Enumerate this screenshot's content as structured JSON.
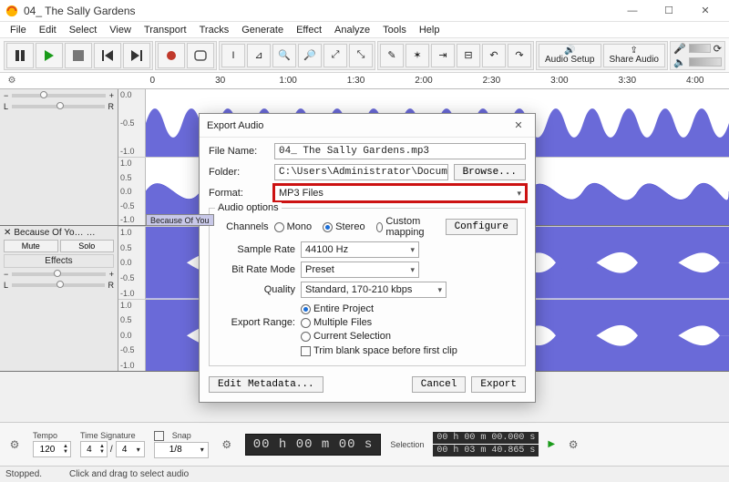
{
  "window": {
    "title": "04_ The Sally Gardens",
    "minimize": "—",
    "maximize": "☐",
    "close": "✕"
  },
  "menu": [
    "File",
    "Edit",
    "Select",
    "View",
    "Transport",
    "Tracks",
    "Generate",
    "Effect",
    "Analyze",
    "Tools",
    "Help"
  ],
  "toolbar": {
    "audio_setup": "Audio Setup",
    "share_audio": "Share Audio"
  },
  "ruler": {
    "marks": [
      "0",
      "30",
      "1:00",
      "1:30",
      "2:00",
      "2:30",
      "3:00",
      "3:30",
      "4:00"
    ]
  },
  "tracks": [
    {
      "name": "",
      "clip_label": "",
      "scale": [
        "1.0",
        "0.5",
        "0.0",
        "-0.5",
        "-1.0"
      ],
      "channels": 2,
      "panel_visible": true
    },
    {
      "name": "Because Of Yo…",
      "mute": "Mute",
      "solo": "Solo",
      "effects": "Effects",
      "pan_l": "L",
      "pan_r": "R",
      "clip_label": "Because Of You",
      "scale": [
        "1.0",
        "0.5",
        "0.0",
        "-0.5",
        "-1.0"
      ],
      "channels": 2,
      "panel_visible": true
    }
  ],
  "bottom": {
    "tempo_label": "Tempo",
    "tempo_value": "120",
    "timesig_label": "Time Signature",
    "timesig_num": "4",
    "timesig_den": "4",
    "snap_label": "Snap",
    "snap_value": "1/8",
    "time_display": "00 h 00 m 00 s",
    "selection_label": "Selection",
    "sel_start": "00 h 00 m 00.000 s",
    "sel_end": "00 h 03 m 40.865 s"
  },
  "status": {
    "left": "Stopped.",
    "hint": "Click and drag to select audio"
  },
  "dialog": {
    "title": "Export Audio",
    "close": "✕",
    "filename_label": "File Name:",
    "filename": "04_ The Sally Gardens.mp3",
    "folder_label": "Folder:",
    "folder": "C:\\Users\\Administrator\\Documents\\Audacity",
    "browse": "Browse...",
    "format_label": "Format:",
    "format": "MP3 Files",
    "audio_options_title": "Audio options",
    "channels_label": "Channels",
    "channels_mono": "Mono",
    "channels_stereo": "Stereo",
    "channels_custom": "Custom mapping",
    "configure": "Configure",
    "sample_rate_label": "Sample Rate",
    "sample_rate": "44100 Hz",
    "bitrate_mode_label": "Bit Rate Mode",
    "bitrate_mode": "Preset",
    "quality_label": "Quality",
    "quality": "Standard, 170-210 kbps",
    "range_label": "Export Range:",
    "range_entire": "Entire Project",
    "range_multiple": "Multiple Files",
    "range_current": "Current Selection",
    "trim_label": "Trim blank space before first clip",
    "edit_meta": "Edit Metadata...",
    "cancel": "Cancel",
    "export": "Export"
  }
}
